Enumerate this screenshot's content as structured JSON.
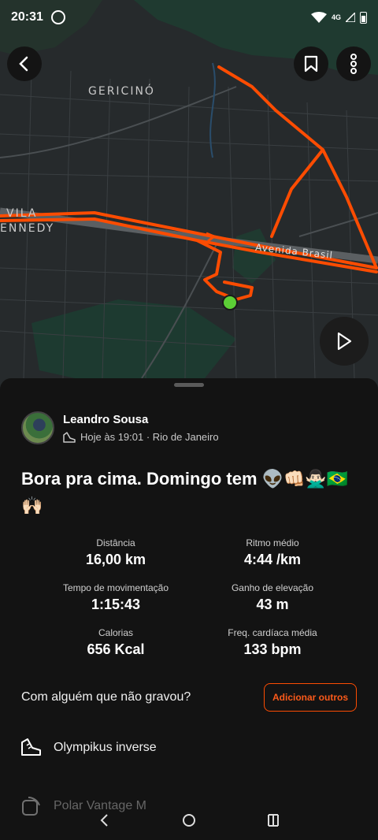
{
  "status_bar": {
    "time": "20:31",
    "network": "4G"
  },
  "map": {
    "labels": {
      "area_1": "GERICINÓ",
      "area_2_line1": "VILA",
      "area_2_line2": "ENNEDY",
      "road": "Avenida Brasil"
    },
    "route_color": "#fc4c02",
    "start_marker_color": "#5ccf36"
  },
  "activity": {
    "athlete_name": "Leandro Sousa",
    "meta": "Hoje às 19:01 · Rio de Janeiro",
    "title": "Bora pra cima. Domingo tem 👽👊🏻🙅🏻‍♂️🇧🇷🙌🏻",
    "stats": [
      {
        "label": "Distância",
        "value": "16,00 km"
      },
      {
        "label": "Ritmo médio",
        "value": "4:44 /km"
      },
      {
        "label": "Tempo de movimentação",
        "value": "1:15:43"
      },
      {
        "label": "Ganho de elevação",
        "value": "43 m"
      },
      {
        "label": "Calorias",
        "value": "656 Kcal"
      },
      {
        "label": "Freq. cardíaca média",
        "value": "133 bpm"
      }
    ],
    "add_prompt": "Com alguém que não gravou?",
    "add_button": "Adicionar outros",
    "gear": "Olympikus inverse",
    "device": "Polar Vantage M"
  },
  "colors": {
    "accent": "#fc4c02",
    "background": "#131313"
  }
}
